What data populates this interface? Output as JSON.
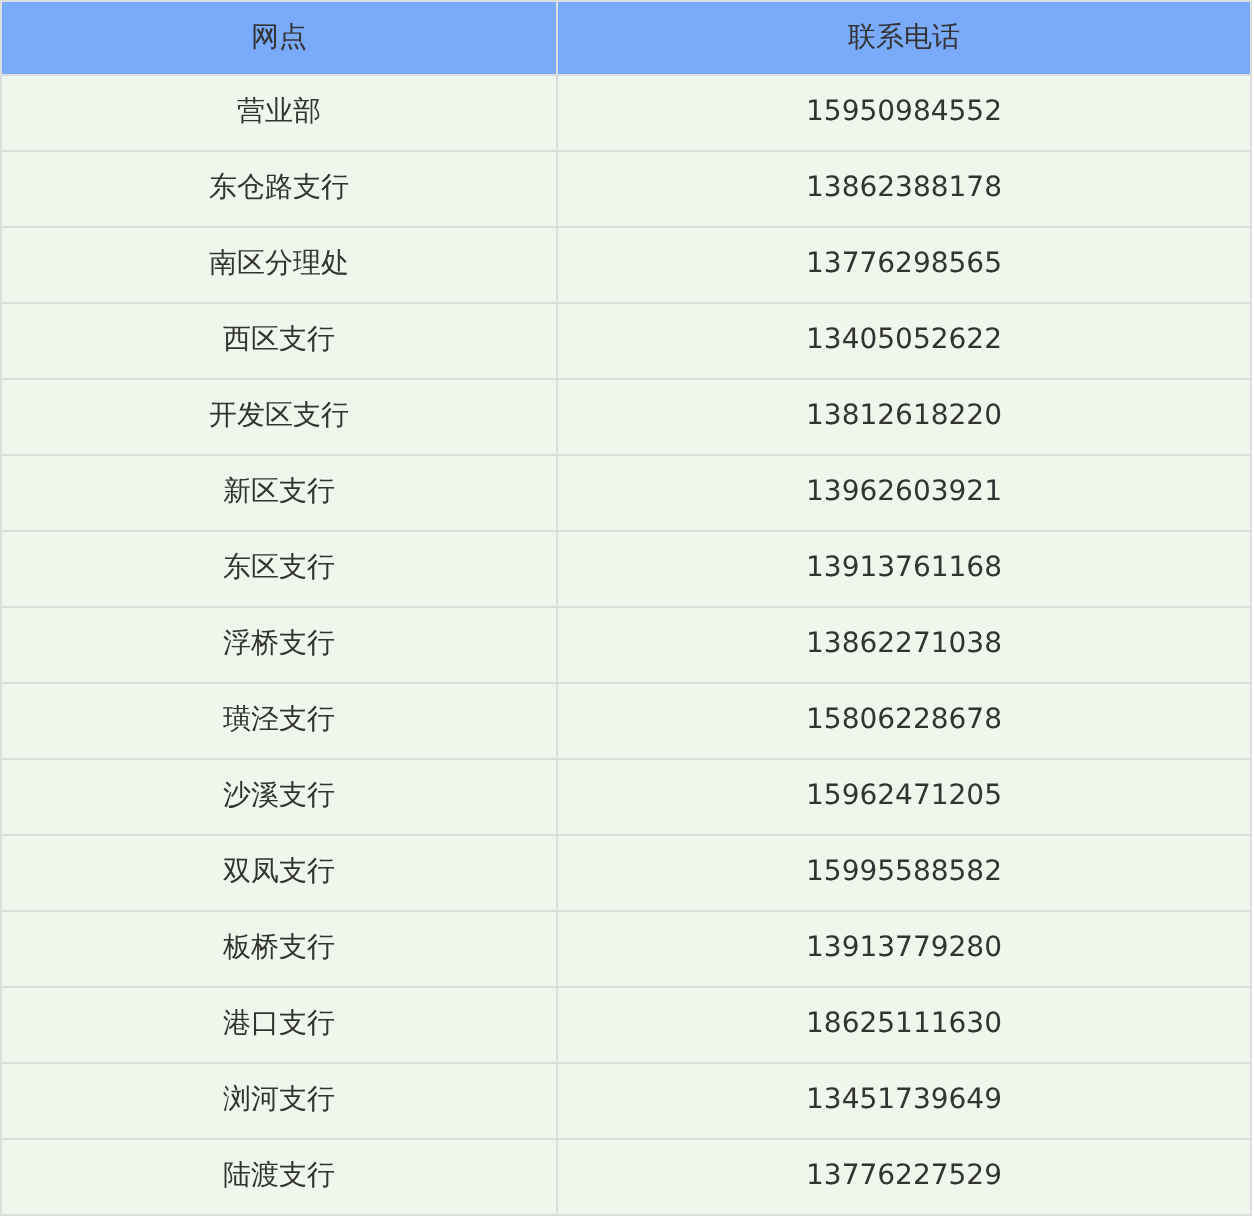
{
  "table": {
    "columns": [
      "网点",
      "联系电话"
    ],
    "rows": [
      [
        "营业部",
        "15950984552"
      ],
      [
        "东仓路支行",
        "13862388178"
      ],
      [
        "南区分理处",
        "13776298565"
      ],
      [
        "西区支行",
        "13405052622"
      ],
      [
        "开发区支行",
        "13812618220"
      ],
      [
        "新区支行",
        "13962603921"
      ],
      [
        "东区支行",
        "13913761168"
      ],
      [
        "浮桥支行",
        "13862271038"
      ],
      [
        "璜泾支行",
        "15806228678"
      ],
      [
        "沙溪支行",
        "15962471205"
      ],
      [
        "双凤支行",
        "15995588582"
      ],
      [
        "板桥支行",
        "13913779280"
      ],
      [
        "港口支行",
        "18625111630"
      ],
      [
        "浏河支行",
        "13451739649"
      ],
      [
        "陆渡支行",
        "13776227529"
      ]
    ]
  }
}
